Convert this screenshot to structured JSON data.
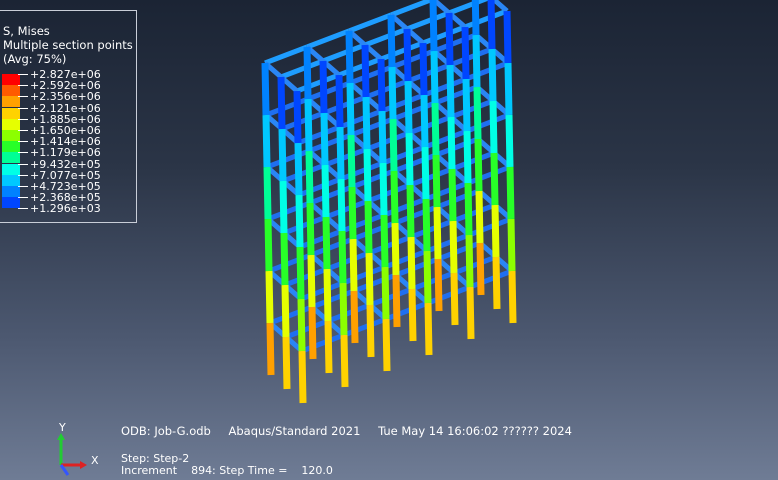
{
  "legend": {
    "title": "S, Mises",
    "subtitle": "Multiple section points",
    "avg": "(Avg: 75%)",
    "values": [
      "+2.827e+06",
      "+2.592e+06",
      "+2.356e+06",
      "+2.121e+06",
      "+1.885e+06",
      "+1.650e+06",
      "+1.414e+06",
      "+1.179e+06",
      "+9.432e+05",
      "+7.077e+05",
      "+4.723e+05",
      "+2.368e+05",
      "+1.296e+03"
    ],
    "colors": [
      "#ff0000",
      "#ff5a00",
      "#ffa000",
      "#ffd200",
      "#e6ff00",
      "#8cff00",
      "#28ff28",
      "#00ff96",
      "#00ffe6",
      "#00c8ff",
      "#0082ff",
      "#0046ff",
      "#0000ff"
    ]
  },
  "info": {
    "odb": "ODB: Job-G.odb",
    "solver": "Abaqus/Standard 2021",
    "date": "Tue May 14 16:06:02 ?????? 2024"
  },
  "step": {
    "step_line": "Step: Step-2",
    "increment_line": "Increment    894: Step Time =    120.0"
  },
  "triad": {
    "y_label": "Y",
    "x_label": "X",
    "y_color": "#22cc33",
    "x_color": "#dd2222",
    "z_color": "#3355ff"
  }
}
